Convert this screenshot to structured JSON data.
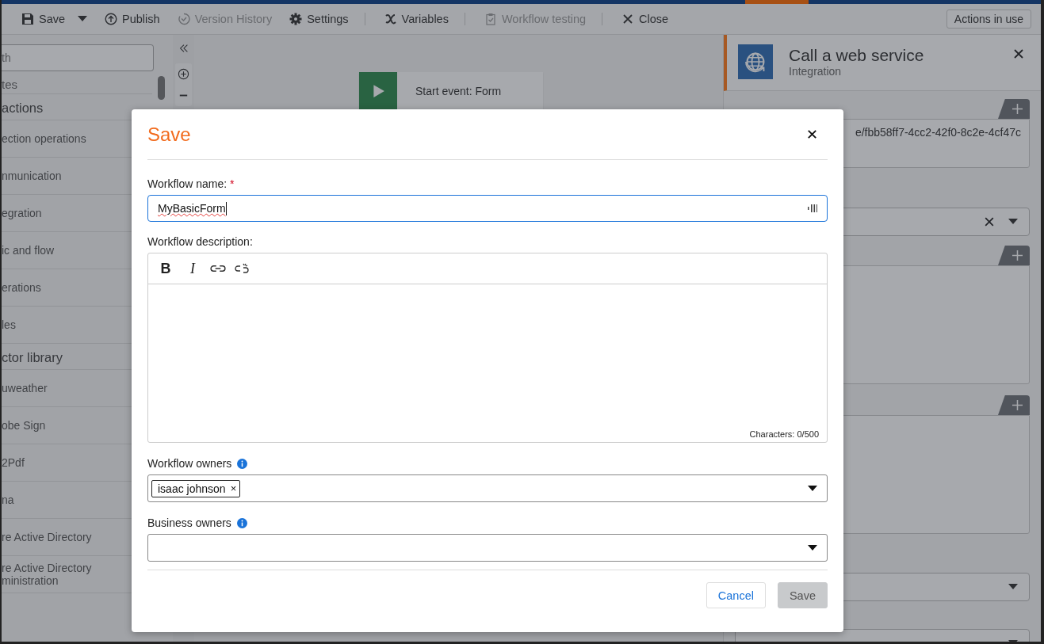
{
  "toolbar": {
    "items": [
      {
        "kind": "save",
        "label": "Save",
        "disabled": false,
        "menu": true,
        "separator_after": false
      },
      {
        "kind": "publish",
        "label": "Publish",
        "disabled": false,
        "menu": false,
        "separator_after": false
      },
      {
        "kind": "history",
        "label": "Version History",
        "disabled": true,
        "menu": false,
        "separator_after": false
      },
      {
        "kind": "settings",
        "label": "Settings",
        "disabled": false,
        "menu": false,
        "separator_after": true
      },
      {
        "kind": "variables",
        "label": "Variables",
        "disabled": false,
        "menu": false,
        "separator_after": true
      },
      {
        "kind": "testing",
        "label": "Workflow testing",
        "disabled": true,
        "menu": false,
        "separator_after": true
      },
      {
        "kind": "close",
        "label": "Close",
        "disabled": false,
        "menu": false,
        "separator_after": false
      }
    ],
    "actions_button": "Actions in use"
  },
  "sidebar": {
    "search_placeholder": "th",
    "items": [
      {
        "kind": "group",
        "label": "tes"
      },
      {
        "kind": "heading",
        "label": "actions"
      },
      {
        "kind": "item",
        "label": "ection operations"
      },
      {
        "kind": "item",
        "label": "nmunication"
      },
      {
        "kind": "item",
        "label": "egration"
      },
      {
        "kind": "item",
        "label": "ic and flow"
      },
      {
        "kind": "item",
        "label": "erations"
      },
      {
        "kind": "item",
        "label": "les"
      },
      {
        "kind": "heading",
        "label": "ctor library"
      },
      {
        "kind": "item",
        "label": "uweather"
      },
      {
        "kind": "item",
        "label": "obe Sign"
      },
      {
        "kind": "item",
        "label": "2Pdf"
      },
      {
        "kind": "item",
        "label": "na"
      },
      {
        "kind": "item",
        "label": "re Active Directory"
      },
      {
        "kind": "item",
        "label": "re Active Directory ministration"
      }
    ]
  },
  "canvas": {
    "start_event": "Start event: Form"
  },
  "panel": {
    "title": "Call a web service",
    "subtitle": "Integration",
    "url_value": "e/fbb58ff7-4cc2-42f0-8c2e-4cf47c"
  },
  "modal": {
    "title": "Save",
    "name_field": {
      "label": "Workflow name:",
      "required_mark": "*",
      "value": "MyBasicForm"
    },
    "description": {
      "label": "Workflow description:",
      "format_buttons": [
        "B",
        "I"
      ],
      "counter": "Characters: 0/500"
    },
    "owners": {
      "label": "Workflow owners",
      "tags": [
        {
          "label": "isaac johnson",
          "remove": "×"
        }
      ]
    },
    "business_owners": {
      "label": "Business owners"
    },
    "buttons": [
      {
        "kind": "secondary",
        "label": "Cancel",
        "disabled": false
      },
      {
        "kind": "primary",
        "label": "Save",
        "disabled": true
      }
    ]
  }
}
